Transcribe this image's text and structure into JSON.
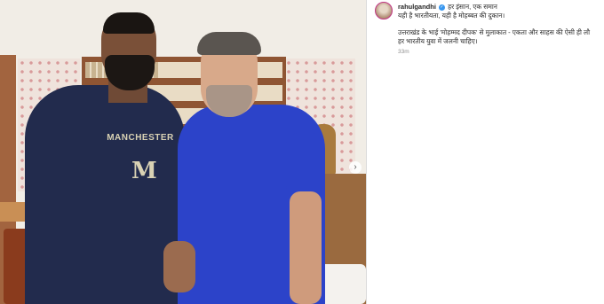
{
  "post": {
    "username": "rahulgandhi",
    "caption_line1": "हर इंसान, एक समान",
    "caption_line2": "यही है भारतीयता, यही है मोहब्बत की दुकान।",
    "caption_para2": "उत्तराखंड के भाई 'मोहम्मद दीपक' से मुलाकात - एकता और साहस की ऐसी ही लौ हर भारतीय युवा में जलनी चाहिए।",
    "timestamp": "33m",
    "verified_icon": "verified-badge-icon"
  },
  "photo": {
    "next_icon": "›",
    "shirt_text": "MANCHESTER",
    "shirt_letter": "M"
  },
  "colors": {
    "verified": "#3897f0",
    "avatar_ring": "#c13584",
    "blue_shirt": "#2c43c9",
    "navy_sweatshirt": "#222b4d"
  }
}
